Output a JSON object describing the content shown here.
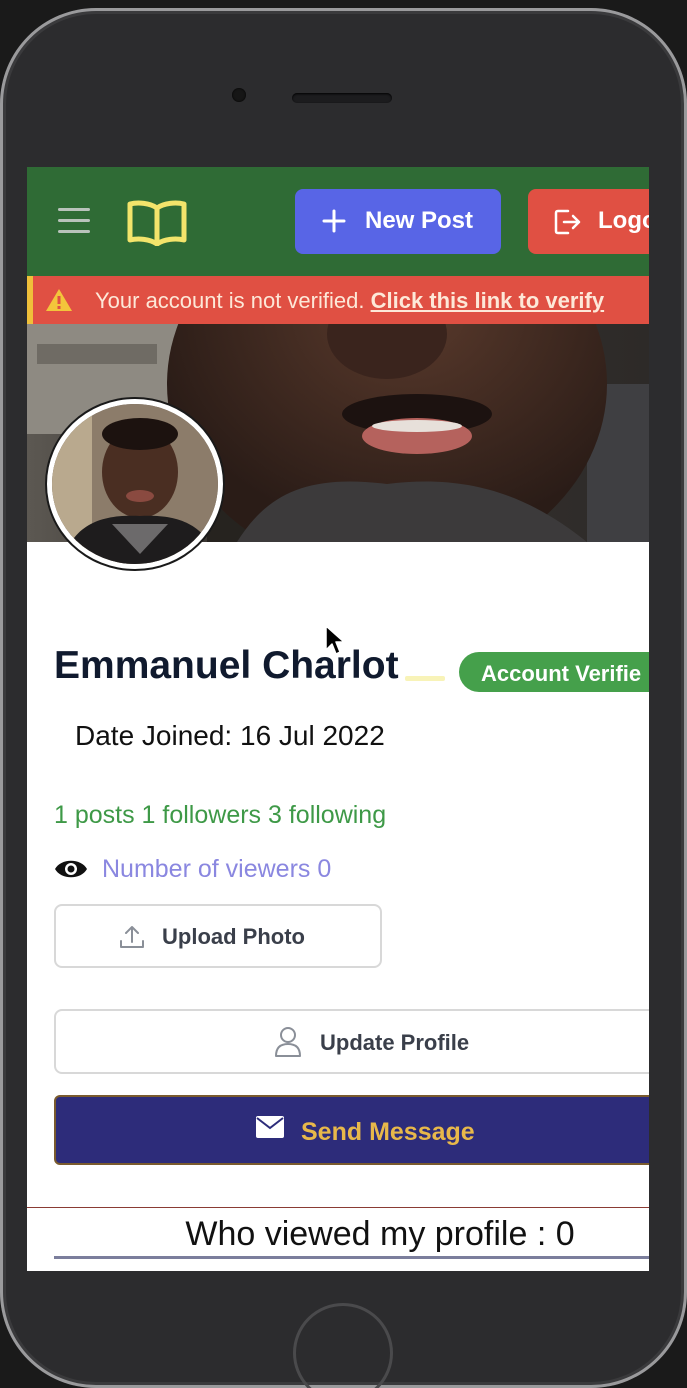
{
  "nav": {
    "new_post_label": "New Post",
    "logout_label": "Logo"
  },
  "alert": {
    "message": "Your account is not verified.",
    "link_text": "Click this link to verify"
  },
  "profile": {
    "name": "Emmanuel Charlot",
    "verified_badge": "Account Verifie",
    "date_joined": "Date Joined: 16 Jul 2022",
    "stats": "1 posts 1 followers 3 following",
    "viewers": "Number of viewers 0"
  },
  "actions": {
    "upload_label": "Upload Photo",
    "update_label": "Update Profile",
    "message_label": "Send Message"
  },
  "viewed": {
    "title": "Who viewed my profile : 0"
  },
  "colors": {
    "navbar": "#2f6b35",
    "new_post": "#5865e6",
    "logout": "#e05043",
    "alert": "#e05043",
    "verified": "#45a04b",
    "stats": "#3e9947",
    "viewers": "#8a87e0",
    "message_btn": "#2d2c7a",
    "message_text": "#e8b84a"
  },
  "icons": [
    "hamburger-icon",
    "book-icon",
    "plus-icon",
    "logout-icon",
    "warning-icon",
    "eye-icon",
    "upload-icon",
    "user-icon",
    "envelope-icon",
    "mouse-cursor-icon"
  ]
}
